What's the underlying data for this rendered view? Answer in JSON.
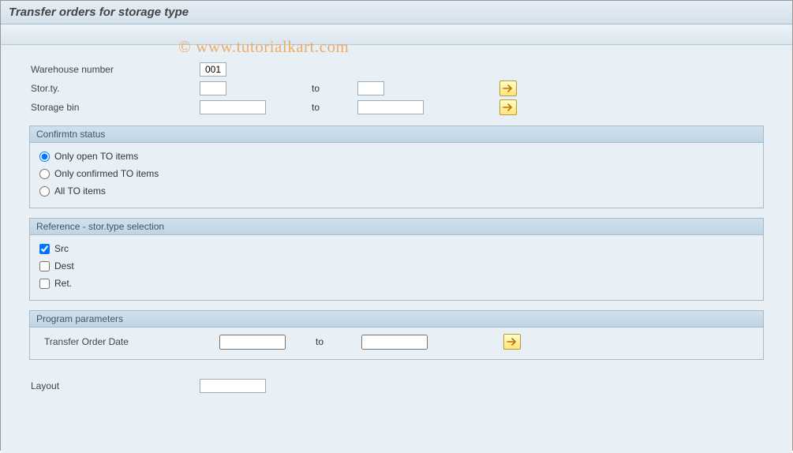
{
  "title": "Transfer orders for storage type",
  "watermark": "© www.tutorialkart.com",
  "fields": {
    "warehouse_number": {
      "label": "Warehouse number",
      "value": "001"
    },
    "stor_ty": {
      "label": "Stor.ty.",
      "from": "",
      "to_label": "to",
      "to": ""
    },
    "storage_bin": {
      "label": "Storage bin",
      "from": "",
      "to_label": "to",
      "to": ""
    },
    "transfer_order_date": {
      "label": "Transfer Order Date",
      "from": "",
      "to_label": "to",
      "to": ""
    },
    "layout": {
      "label": "Layout",
      "value": ""
    }
  },
  "groups": {
    "confirm": {
      "title": "Confirmtn status",
      "options": {
        "open": "Only open TO items",
        "confirmed": "Only confirmed TO items",
        "all": "All TO items"
      },
      "selected": "open"
    },
    "reference": {
      "title": "Reference - stor.type selection",
      "checks": {
        "src": {
          "label": "Src",
          "checked": true
        },
        "dest": {
          "label": "Dest",
          "checked": false
        },
        "ret": {
          "label": "Ret.",
          "checked": false
        }
      }
    },
    "params": {
      "title": "Program parameters"
    }
  }
}
